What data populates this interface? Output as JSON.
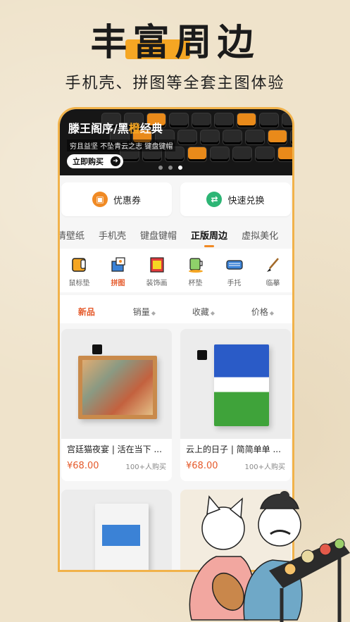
{
  "headline": "丰富周边",
  "subline": "手机壳、拼图等全套主图体验",
  "banner": {
    "title_prefix": "滕王阁序/黑",
    "title_highlight": "橙",
    "title_suffix": "经典",
    "subtitle": "穷且益坚 不坠青云之志 键盘键帽",
    "buy_label": "立即购买",
    "buy_arrow": "➜"
  },
  "actions": [
    {
      "label": "优惠券",
      "icon": "coupon-icon",
      "glyph": "▣",
      "color": "#f08a24"
    },
    {
      "label": "快速兑换",
      "icon": "exchange-icon",
      "glyph": "⇄",
      "color": "#2db575"
    }
  ],
  "tabs": [
    {
      "label": "清壁纸",
      "active": false
    },
    {
      "label": "手机壳",
      "active": false
    },
    {
      "label": "键盘键帽",
      "active": false
    },
    {
      "label": "正版周边",
      "active": true
    },
    {
      "label": "虚拟美化",
      "active": false
    }
  ],
  "subcats": [
    {
      "label": "鼠标垫",
      "icon": "mousepad-icon",
      "active": false
    },
    {
      "label": "拼图",
      "icon": "puzzle-icon",
      "active": true
    },
    {
      "label": "装饰画",
      "icon": "painting-icon",
      "active": false
    },
    {
      "label": "杯垫",
      "icon": "coaster-icon",
      "active": false
    },
    {
      "label": "手托",
      "icon": "wrist-rest-icon",
      "active": false
    },
    {
      "label": "临摹",
      "icon": "brush-icon",
      "active": false
    }
  ],
  "sorts": [
    {
      "label": "新品",
      "active": true,
      "updown": ""
    },
    {
      "label": "销量",
      "active": false,
      "updown": "◆"
    },
    {
      "label": "收藏",
      "active": false,
      "updown": "◆"
    },
    {
      "label": "价格",
      "active": false,
      "updown": "◆"
    }
  ],
  "products": [
    {
      "name": "宫廷猫夜宴 | 活在当下 ...",
      "price": "¥68.00",
      "sold": "100+人购买"
    },
    {
      "name": "云上的日子 | 简简单单 ...",
      "price": "¥68.00",
      "sold": "100+人购买"
    }
  ],
  "colors": {
    "accent": "#f08a24",
    "price": "#e55a2b",
    "frame": "#f1b24a",
    "headline_bar": "#f5a623"
  }
}
